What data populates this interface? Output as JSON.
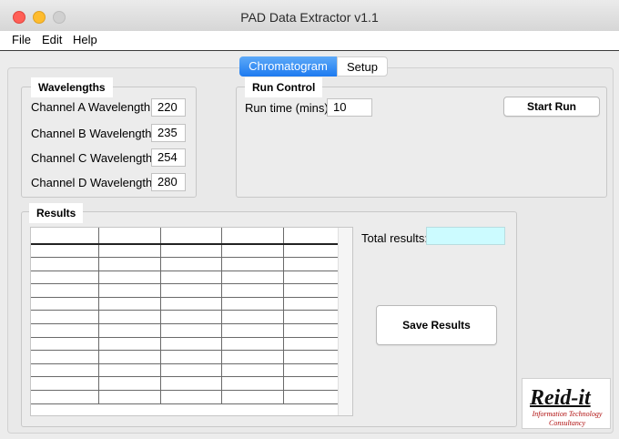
{
  "window": {
    "title": "PAD Data Extractor v1.1"
  },
  "menu": {
    "file": "File",
    "edit": "Edit",
    "help": "Help"
  },
  "tabs": [
    {
      "label": "Chromatogram",
      "selected": true
    },
    {
      "label": "Setup",
      "selected": false
    }
  ],
  "wavelengths": {
    "title": "Wavelengths",
    "channels": [
      {
        "label": "Channel A Wavelength:",
        "value": "220"
      },
      {
        "label": "Channel B Wavelength:",
        "value": "235"
      },
      {
        "label": "Channel C Wavelength:",
        "value": "254"
      },
      {
        "label": "Channel D Wavelength:",
        "value": "280"
      }
    ]
  },
  "run_control": {
    "title": "Run Control",
    "run_time_label": "Run time (mins):",
    "run_time_value": "10",
    "start_button": "Start Run"
  },
  "results": {
    "title": "Results",
    "total_label": "Total results:",
    "total_value": "",
    "save_button": "Save Results"
  },
  "logo": {
    "name": "Reid-it",
    "line1": "Information Technology",
    "line2": "Consultancy"
  },
  "colors": {
    "tab_active": "#1d7af0",
    "total_field_bg": "#ccfbff",
    "logo_sub": "#b01010"
  }
}
